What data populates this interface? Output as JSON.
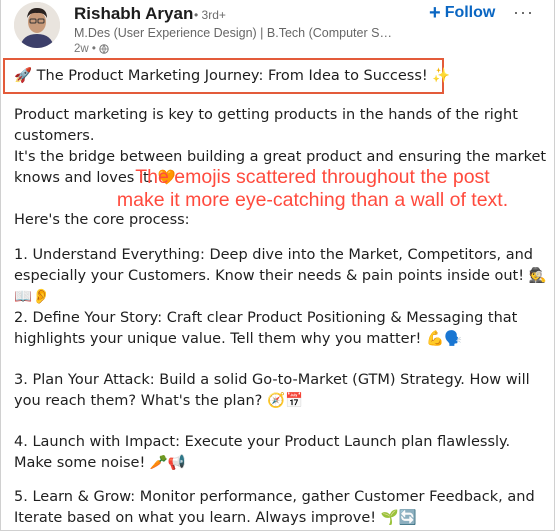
{
  "author": {
    "name": "Rishabh Aryan",
    "degree": "• 3rd+",
    "headline": "M.Des (User Experience Design) | B.Tech (Computer Science and...",
    "time": "2w •"
  },
  "actions": {
    "follow_label": "Follow",
    "follow_icon": "+",
    "more_label": "···"
  },
  "post": {
    "title": "🚀 The Product Marketing Journey: From Idea to Success! ✨",
    "intro": "Product marketing is key to getting products in the hands of the right customers.",
    "bridge": "It's the bridge between building a great product and ensuring the market knows and loves it. 🧡",
    "core": "Here's the core process:",
    "steps": [
      "1. Understand Everything: Deep dive into the Market, Competitors, and especially your Customers. Know their needs & pain points inside out! 🕵️📖👂",
      "2. Define Your Story: Craft clear Product Positioning & Messaging that highlights your unique value. Tell them why you matter! 💪🗣️",
      "3. Plan Your Attack: Build a solid Go-to-Market (GTM) Strategy. How will you reach them? What's the plan? 🧭📅",
      "4. Launch with Impact: Execute your Product Launch plan flawlessly. Make some noise! 🥕📢",
      "5. Learn & Grow: Monitor performance, gather Customer Feedback, and Iterate based on what you learn. Always improve! 🌱🔄"
    ]
  },
  "annotation": {
    "line1": "The emojis scattered throughout the post",
    "line2": "make it more eye-catching than a wall of text.",
    "color": "#ff4a3d"
  },
  "colors": {
    "accent": "#0a66c2",
    "highlight_border": "#e35b3a"
  }
}
